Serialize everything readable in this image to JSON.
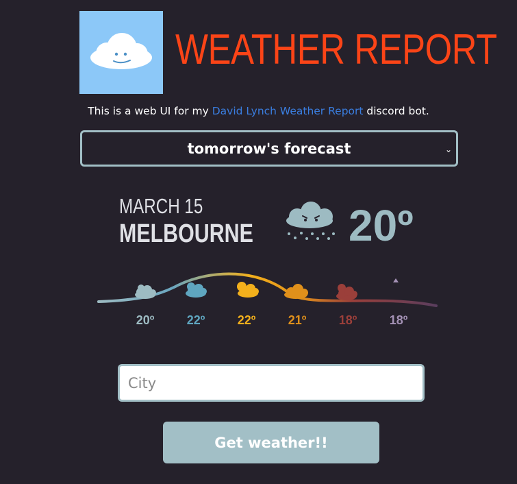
{
  "header": {
    "title": "WEATHER REPORT",
    "logo_icon": "smiling-cloud-icon",
    "logo_bg": "#8cc8f8",
    "title_color": "#fb4417"
  },
  "intro": {
    "prefix": "This is a web UI for my ",
    "link_text": "David Lynch Weather Report",
    "suffix": " discord bot."
  },
  "forecast_select": {
    "selected": "tomorrow's forecast"
  },
  "report": {
    "date": "MARCH 15",
    "city": "MELBOURNE",
    "temperature": "20º",
    "icon": "rain-cloud-icon"
  },
  "hourly": [
    {
      "temp": "20º",
      "icon": "storm-cloud-icon",
      "color": "#9dbbc2"
    },
    {
      "temp": "22º",
      "icon": "partly-cloudy-icon",
      "color": "#5fa6c0"
    },
    {
      "temp": "22º",
      "icon": "sun-cloud-icon",
      "color": "#f3b01c"
    },
    {
      "temp": "21º",
      "icon": "cloud-icon",
      "color": "#e0901b"
    },
    {
      "temp": "18º",
      "icon": "sunset-cloud-icon",
      "color": "#9b3f3a"
    },
    {
      "temp": "18º",
      "icon": "moon-icon",
      "color": "#a592b6"
    }
  ],
  "form": {
    "city_placeholder": "City",
    "submit_label": "Get weather!!"
  }
}
